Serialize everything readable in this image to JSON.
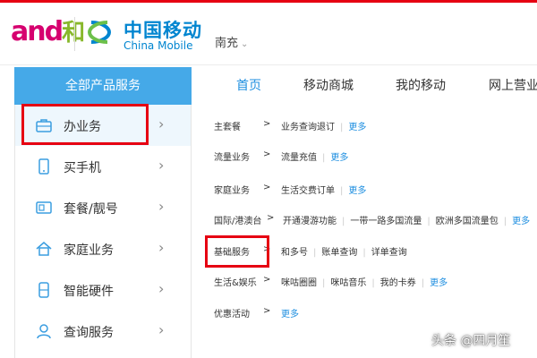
{
  "header": {
    "logo_and": "and",
    "logo_he": "和",
    "brand_cn": "中国移动",
    "brand_en": "China Mobile",
    "city": "南充",
    "accent": "#e60012",
    "brand_color": "#0085d0"
  },
  "all_products": "全部产品服务",
  "nav": {
    "items": [
      "首页",
      "移动商城",
      "我的移动",
      "网上营业"
    ],
    "active_color": "#1f8fe0"
  },
  "sidebar": {
    "items": [
      {
        "label": "办业务",
        "icon": "briefcase-icon"
      },
      {
        "label": "买手机",
        "icon": "phone-icon"
      },
      {
        "label": "套餐/靓号",
        "icon": "sim-card-icon"
      },
      {
        "label": "家庭业务",
        "icon": "home-icon"
      },
      {
        "label": "智能硬件",
        "icon": "device-icon"
      },
      {
        "label": "查询服务",
        "icon": "user-icon"
      }
    ],
    "arrow": "›",
    "header_color": "#45a9e8"
  },
  "panel": {
    "rows": [
      {
        "category": "主套餐",
        "links": [
          "业务查询退订"
        ],
        "more": "更多"
      },
      {
        "category": "流量业务",
        "links": [
          "流量充值"
        ],
        "more": "更多"
      },
      {
        "category": "家庭业务",
        "links": [
          "生活交费订单"
        ],
        "more": "更多"
      },
      {
        "category": "国际/港澳台",
        "links": [
          "开通漫游功能",
          "一带一路多国流量",
          "欧洲多国流量包"
        ],
        "more": "更多"
      },
      {
        "category": "基础服务",
        "links": [
          "和多号",
          "账单查询",
          "详单查询"
        ],
        "more": ""
      },
      {
        "category": "生活&娱乐",
        "links": [
          "咪咕圈圈",
          "咪咕音乐",
          "我的卡券"
        ],
        "more": "更多"
      },
      {
        "category": "优惠活动",
        "links": [],
        "more": "更多"
      }
    ],
    "gt": ">"
  },
  "watermark": "头条 @四月笙"
}
